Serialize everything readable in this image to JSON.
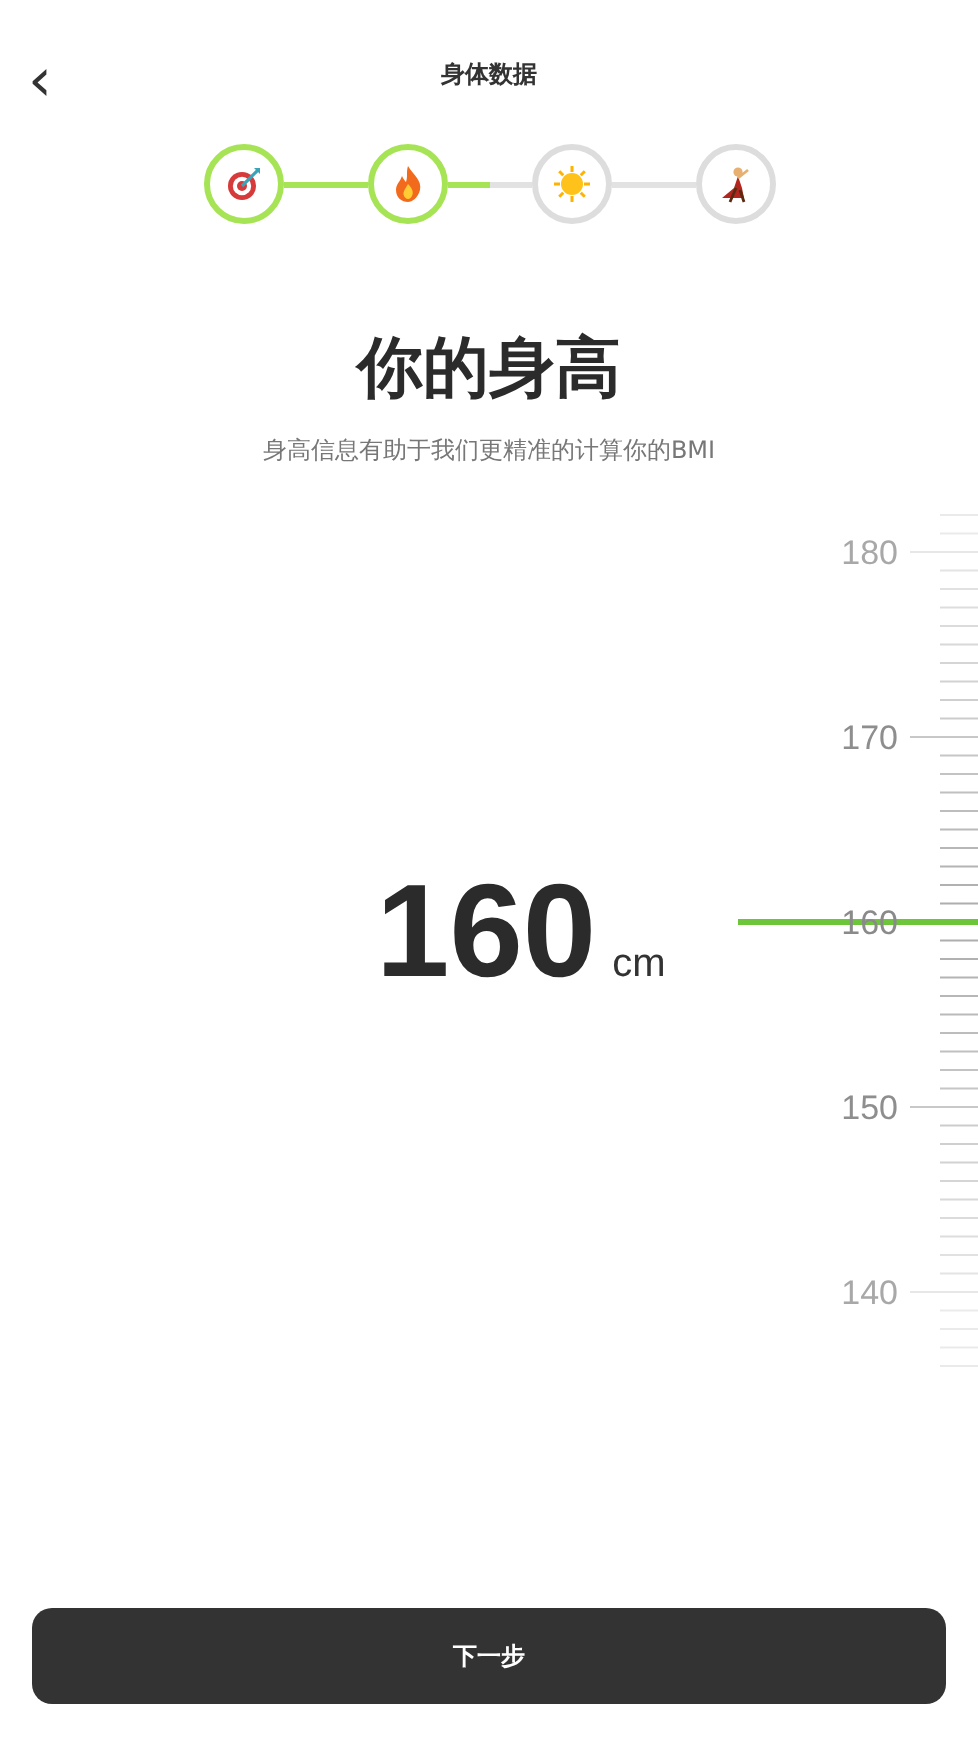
{
  "header": {
    "back": "‹",
    "title": "身体数据"
  },
  "steps": [
    {
      "kind": "target",
      "done": true
    },
    {
      "kind": "flame",
      "done": true
    },
    {
      "kind": "sun",
      "done": false
    },
    {
      "kind": "figure",
      "done": false
    }
  ],
  "connectors": [
    {
      "level": 1
    },
    {
      "level": 0.5
    }
  ],
  "heading": "你的身高",
  "subtitle": "身高信息有助于我们更精准的计算你的BMI",
  "reading": {
    "value": "160",
    "unit": "cm"
  },
  "ruler": {
    "labels": [
      "180",
      "170",
      "160",
      "150",
      "140"
    ]
  },
  "next_button": "下一步"
}
